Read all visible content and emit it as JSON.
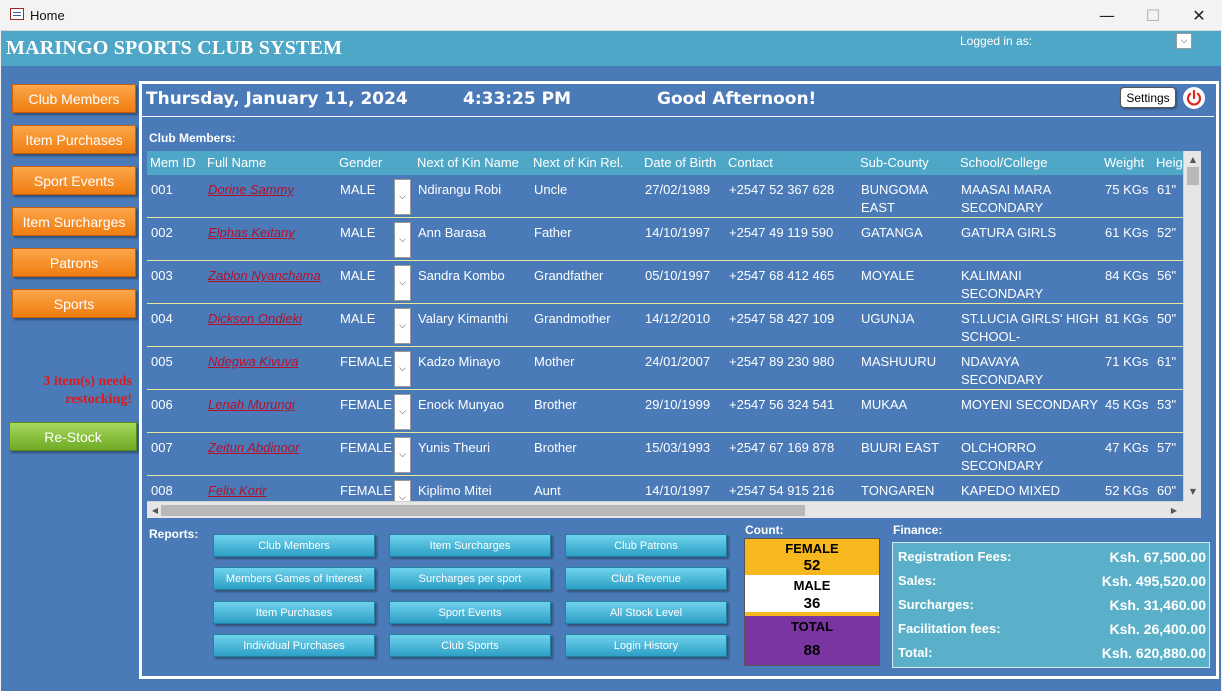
{
  "window": {
    "title": "Home",
    "minimize": "—",
    "maximize": "☐",
    "close": "✕"
  },
  "header": {
    "app_title": "MARINGO SPORTS CLUB SYSTEM",
    "logged_in_label": "Logged in as:",
    "user_dropdown_icon": "chevron-down"
  },
  "sidebar": {
    "items": [
      {
        "label": "Club Members"
      },
      {
        "label": "Item Purchases"
      },
      {
        "label": "Sport Events"
      },
      {
        "label": "Item Surcharges"
      },
      {
        "label": "Patrons"
      },
      {
        "label": "Sports"
      }
    ],
    "alert_text": "3 item(s) needs restocking!",
    "restock_label": "Re-Stock"
  },
  "topbar": {
    "date": "Thursday, January 11, 2024",
    "time": "4:33:25 PM",
    "greeting": "Good Afternoon!",
    "settings_label": "Settings"
  },
  "members": {
    "section_label": "Club Members:",
    "columns": [
      "Mem ID",
      "Full Name",
      "Gender",
      "Next of Kin Name",
      "Next of Kin Rel.",
      "Date of Birth",
      "Contact",
      "Sub-County",
      "School/College",
      "Weight",
      "Heig"
    ],
    "rows": [
      {
        "id": "001",
        "name": "Dorine Sammy",
        "gender": "MALE",
        "kin": "Ndirangu Robi",
        "rel": "Uncle",
        "dob": "27/02/1989",
        "contact": "+2547 52 367 628",
        "county": "BUNGOMA EAST",
        "school": "MAASAI MARA SECONDARY",
        "weight": "75 KGs",
        "height": "61\""
      },
      {
        "id": "002",
        "name": "Elphas Keitany",
        "gender": "MALE",
        "kin": "Ann Barasa",
        "rel": "Father",
        "dob": "14/10/1997",
        "contact": "+2547 49 119 590",
        "county": "GATANGA",
        "school": "GATURA GIRLS",
        "weight": "61 KGs",
        "height": "52\""
      },
      {
        "id": "003",
        "name": "Zablon Nyanchama",
        "gender": "MALE",
        "kin": "Sandra Kombo",
        "rel": "Grandfather",
        "dob": "05/10/1997",
        "contact": "+2547 68 412 465",
        "county": "MOYALE",
        "school": "KALIMANI SECONDARY",
        "weight": "84 KGs",
        "height": "56\""
      },
      {
        "id": "004",
        "name": "Dickson Ondieki",
        "gender": "MALE",
        "kin": "Valary Kimanthi",
        "rel": "Grandmother",
        "dob": "14/12/2010",
        "contact": "+2547 58 427 109",
        "county": "UGUNJA",
        "school": "ST.LUCIA GIRLS' HIGH SCHOOL-",
        "weight": "81 KGs",
        "height": "50\""
      },
      {
        "id": "005",
        "name": "Ndegwa Kivuva",
        "gender": "FEMALE",
        "kin": "Kadzo Minayo",
        "rel": "Mother",
        "dob": "24/01/2007",
        "contact": "+2547 89 230 980",
        "county": "MASHUURU",
        "school": "NDAVAYA SECONDARY",
        "weight": "71 KGs",
        "height": "61\""
      },
      {
        "id": "006",
        "name": "Lenah Murungi",
        "gender": "FEMALE",
        "kin": "Enock Munyao",
        "rel": "Brother",
        "dob": "29/10/1999",
        "contact": "+2547 56 324 541",
        "county": "MUKAA",
        "school": "MOYENI SECONDARY",
        "weight": "45 KGs",
        "height": "53\""
      },
      {
        "id": "007",
        "name": "Zeitun Abdinoor",
        "gender": "FEMALE",
        "kin": "Yunis Theuri",
        "rel": "Brother",
        "dob": "15/03/1993",
        "contact": "+2547 67 169 878",
        "county": "BUURI EAST",
        "school": "OLCHORRO SECONDARY",
        "weight": "47 KGs",
        "height": "57\""
      },
      {
        "id": "008",
        "name": "Felix Korir",
        "gender": "FEMALE",
        "kin": "Kiplimo Mitei",
        "rel": "Aunt",
        "dob": "14/10/1997",
        "contact": "+2547 54 915 216",
        "county": "TONGAREN",
        "school": "KAPEDO MIXED",
        "weight": "52 KGs",
        "height": "60\""
      }
    ]
  },
  "reports": {
    "section_label": "Reports:",
    "buttons": [
      "Club Members",
      "Item Surcharges",
      "Club Patrons",
      "Members Games of Interest",
      "Surcharges per sport",
      "Club Revenue",
      "Item Purchases",
      "Sport Events",
      "All Stock Level",
      "Individual Purchases",
      "Club Sports",
      "Login History"
    ]
  },
  "count": {
    "section_label": "Count:",
    "female_label": "FEMALE",
    "female_value": "52",
    "male_label": "MALE",
    "male_value": "36",
    "total_label": "TOTAL",
    "total_value": "88",
    "colors": {
      "female": "#f6b81e",
      "male": "#ffffff",
      "total": "#7a35a3"
    }
  },
  "finance": {
    "section_label": "Finance:",
    "rows": [
      {
        "label": "Registration Fees:",
        "value": "Ksh. 67,500.00"
      },
      {
        "label": "Sales:",
        "value": "Ksh. 495,520.00"
      },
      {
        "label": "Surcharges:",
        "value": "Ksh. 31,460.00"
      },
      {
        "label": "Facilitation fees:",
        "value": "Ksh. 26,400.00"
      },
      {
        "label": "Total:",
        "value": "Ksh. 620,880.00"
      }
    ]
  },
  "theme": {
    "background": "#4a7ab8",
    "header": "#4fa7c7",
    "nav_button": "#f07d10",
    "restock_button": "#6faa25",
    "report_button": "#2d9fc6",
    "name_link": "#b3122b",
    "alert": "#e01818"
  }
}
